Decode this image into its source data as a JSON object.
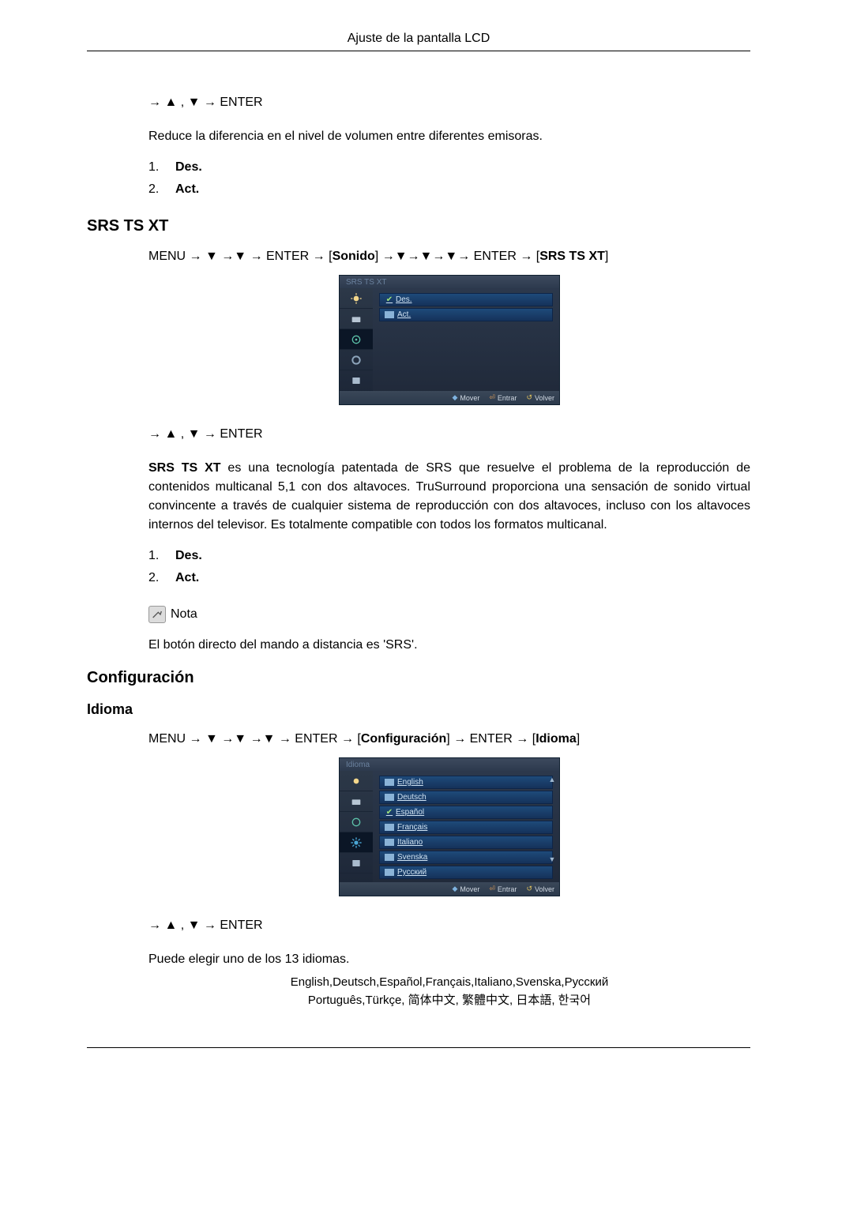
{
  "page_header": "Ajuste de la pantalla LCD",
  "nav1": "→ ▲ , ▼ → ENTER",
  "desc1": "Reduce la diferencia en el nivel de volumen entre diferentes emisoras.",
  "list1": [
    {
      "num": "1.",
      "label": "Des."
    },
    {
      "num": "2.",
      "label": "Act."
    }
  ],
  "srs": {
    "heading": "SRS TS XT",
    "menu_path_parts": {
      "p1": "MENU → ▼ →▼ → ENTER → [",
      "p2": "Sonido",
      "p3": "] →▼→▼→▼→ ENTER → [",
      "p4": "SRS TS XT",
      "p5": "]"
    },
    "osd": {
      "title": "SRS TS XT",
      "rows": [
        {
          "checked": true,
          "label": "Des."
        },
        {
          "checked": false,
          "label": "Act."
        }
      ],
      "footer": {
        "mover": "Mover",
        "entrar": "Entrar",
        "volver": "Volver"
      }
    },
    "nav2": "→ ▲ , ▼ → ENTER",
    "desc2_bold": "SRS TS XT",
    "desc2": " es una tecnología patentada de SRS que resuelve el problema de la reproducción de contenidos multicanal 5,1 con dos altavoces. TruSurround proporciona una sensación de sonido virtual convincente a través de cualquier sistema de reproducción con dos altavoces, incluso con los altavoces internos del televisor. Es totalmente compatible con todos los formatos multicanal.",
    "list2": [
      {
        "num": "1.",
        "label": "Des."
      },
      {
        "num": "2.",
        "label": "Act."
      }
    ],
    "note_label": "Nota",
    "note_text": "El botón directo del mando a distancia es 'SRS'."
  },
  "config": {
    "heading": "Configuración",
    "sub": "Idioma",
    "menu_path_parts": {
      "p1": "MENU → ▼ →▼ →▼ → ENTER → [",
      "p2": "Configuración",
      "p3": "] → ENTER → [",
      "p4": "Idioma",
      "p5": "]"
    },
    "osd": {
      "title": "Idioma",
      "rows": [
        {
          "checked": false,
          "label": "English"
        },
        {
          "checked": false,
          "label": "Deutsch"
        },
        {
          "checked": true,
          "label": "Español"
        },
        {
          "checked": false,
          "label": "Français"
        },
        {
          "checked": false,
          "label": "Italiano"
        },
        {
          "checked": false,
          "label": "Svenska"
        },
        {
          "checked": false,
          "label": "Русский"
        }
      ],
      "footer": {
        "mover": "Mover",
        "entrar": "Entrar",
        "volver": "Volver"
      }
    },
    "nav3": "→ ▲ , ▼ → ENTER",
    "desc3": "Puede elegir uno de los 13 idiomas.",
    "langs_line1": "English,Deutsch,Español,Français,Italiano,Svenska,Русский",
    "langs_line2": "Português,Türkçe, 简体中文,  繁體中文, 日本語, 한국어"
  }
}
